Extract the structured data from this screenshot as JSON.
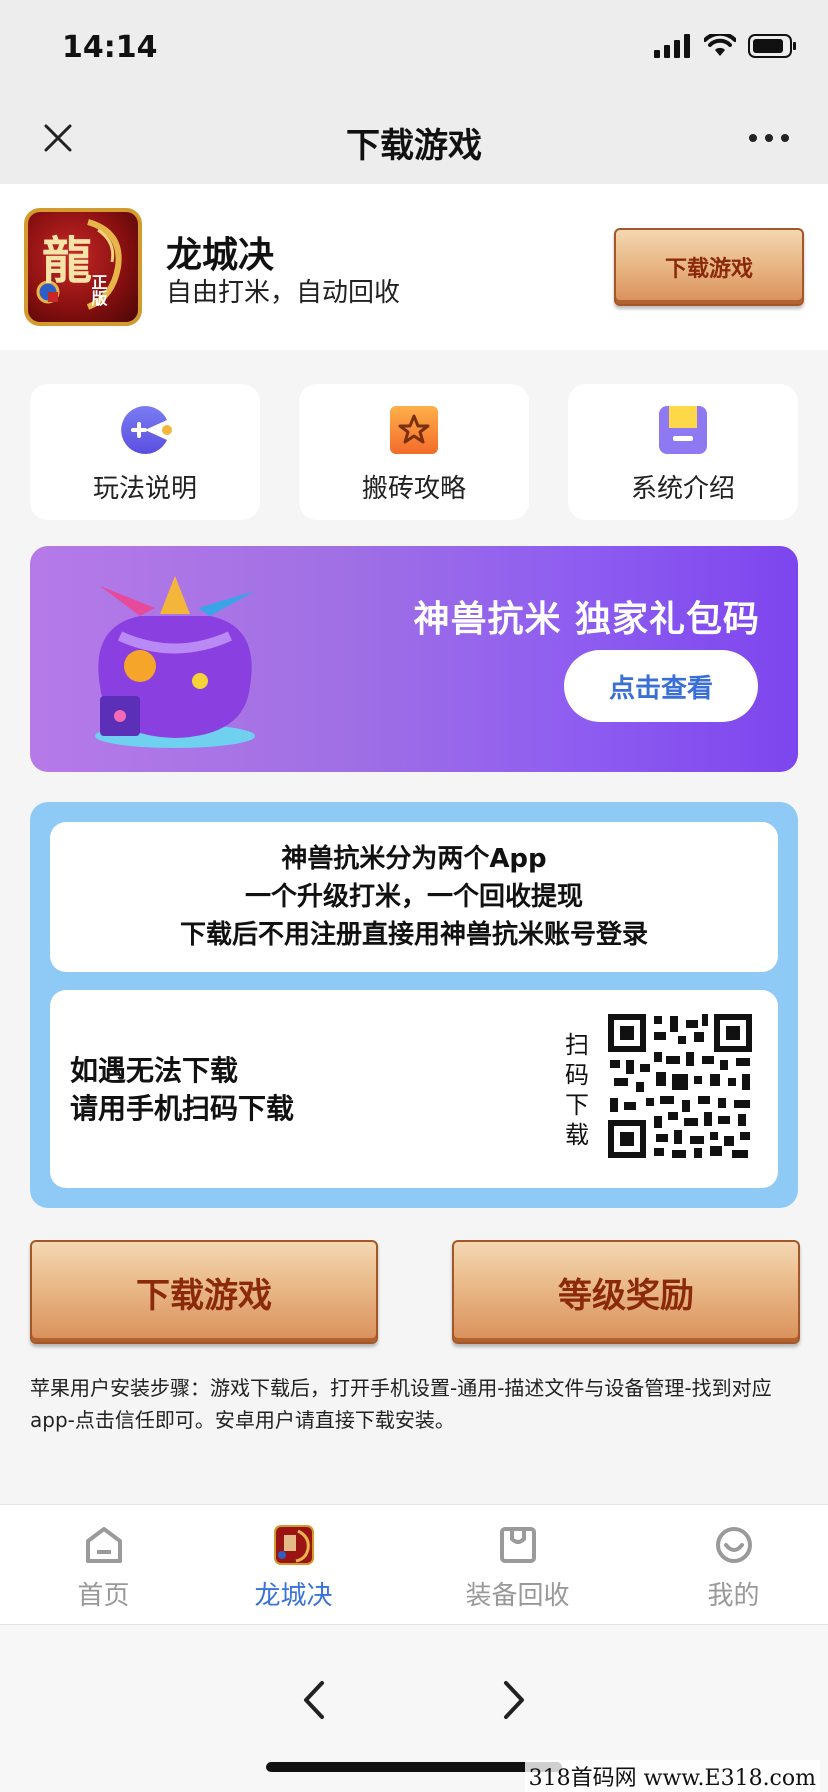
{
  "status_bar": {
    "time": "14:14"
  },
  "nav": {
    "title": "下载游戏"
  },
  "app": {
    "name": "龙城决",
    "subtitle": "自由打米，自动回收",
    "download_label": "下载游戏",
    "icon_text": "龍",
    "icon_badge": "正版"
  },
  "quick_links": [
    {
      "label": "玩法说明",
      "icon": "pacman-icon"
    },
    {
      "label": "搬砖攻略",
      "icon": "star-icon"
    },
    {
      "label": "系统介绍",
      "icon": "folder-icon"
    }
  ],
  "banner": {
    "title": "神兽抗米 独家礼包码",
    "button_label": "点击查看"
  },
  "info": {
    "lines": [
      "神兽抗米分为两个App",
      "一个升级打米，一个回收提现",
      "下载后不用注册直接用神兽抗米账号登录"
    ],
    "qr_line1": "如遇无法下载",
    "qr_line2": "请用手机扫码下载",
    "qr_vertical": [
      "扫",
      "码",
      "下",
      "载"
    ]
  },
  "actions": {
    "download_label": "下载游戏",
    "reward_label": "等级奖励"
  },
  "install_note": "苹果用户安装步骤：游戏下载后，打开手机设置-通用-描述文件与设备管理-找到对应app-点击信任即可。安卓用户请直接下载安装。",
  "tabs": [
    {
      "label": "首页",
      "active": false
    },
    {
      "label": "龙城决",
      "active": true
    },
    {
      "label": "装备回收",
      "active": false
    },
    {
      "label": "我的",
      "active": false
    }
  ],
  "watermark": "318首码网 www.E318.com",
  "colors": {
    "accent_blue": "#3b74d9",
    "banner_purple": "#8f5ef0",
    "panel_blue": "#8fc9f5",
    "wood_button": "#e9b887"
  }
}
